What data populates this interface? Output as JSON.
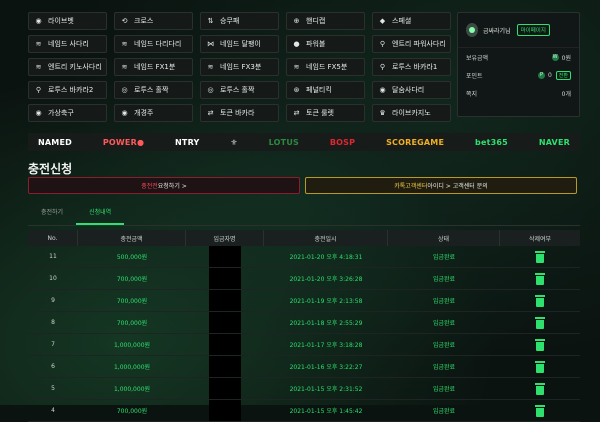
{
  "menu": [
    {
      "icon": "live-icon",
      "glyph": "◉",
      "label": "라이브벳"
    },
    {
      "icon": "cross-icon",
      "glyph": "⟲",
      "label": "크로스"
    },
    {
      "icon": "win-lose-icon",
      "glyph": "⇅",
      "label": "승무패"
    },
    {
      "icon": "handicap-icon",
      "glyph": "⊕",
      "label": "핸디캡"
    },
    {
      "icon": "special-icon",
      "glyph": "◆",
      "label": "스페셜"
    },
    {
      "icon": "ladder-icon",
      "glyph": "≋",
      "label": "네임드 사다리"
    },
    {
      "icon": "ladder-icon",
      "glyph": "≋",
      "label": "네임드 다리다리"
    },
    {
      "icon": "snail-icon",
      "glyph": "⋈",
      "label": "네임드 달팽이"
    },
    {
      "icon": "powerball-icon",
      "glyph": "●",
      "label": "파워볼"
    },
    {
      "icon": "ladder-icon",
      "glyph": "⚲",
      "label": "엔트리 파워사다리"
    },
    {
      "icon": "ladder-icon",
      "glyph": "≋",
      "label": "엔트리 키노사다리"
    },
    {
      "icon": "fx-icon",
      "glyph": "≋",
      "label": "네임드 FX1분"
    },
    {
      "icon": "fx-icon",
      "glyph": "≋",
      "label": "네임드 FX3분"
    },
    {
      "icon": "fx-icon",
      "glyph": "≋",
      "label": "네임드 FX5분"
    },
    {
      "icon": "baccarat-icon",
      "glyph": "⚲",
      "label": "로투스 바카라1"
    },
    {
      "icon": "baccarat-icon",
      "glyph": "⚲",
      "label": "로투스 바카라2"
    },
    {
      "icon": "odd-even-icon",
      "glyph": "◎",
      "label": "로투스 홀짝"
    },
    {
      "icon": "odd-even-icon",
      "glyph": "◎",
      "label": "로투스 홀짝"
    },
    {
      "icon": "penalty-icon",
      "glyph": "⊛",
      "label": "페널티킥"
    },
    {
      "icon": "ladder-icon",
      "glyph": "◉",
      "label": "달숨사다리"
    },
    {
      "icon": "soccer-icon",
      "glyph": "◉",
      "label": "가상축구"
    },
    {
      "icon": "horse-icon",
      "glyph": "◉",
      "label": "개경주"
    },
    {
      "icon": "baccarat-icon",
      "glyph": "⇄",
      "label": "토큰 바카라"
    },
    {
      "icon": "roulette-icon",
      "glyph": "⇄",
      "label": "토큰 룰렛"
    },
    {
      "icon": "crown-icon",
      "glyph": "♛",
      "label": "라이브카지노"
    }
  ],
  "user_panel": {
    "username": "금싸라기님",
    "mypage_label": "마이페이지",
    "balance_label": "보유금액",
    "balance_value": "0원",
    "point_label": "포인트",
    "point_value": "0",
    "convert_label": "전환",
    "message_label": "쪽지",
    "message_value": "0개"
  },
  "logos": [
    {
      "name": "named-logo",
      "text": "NAMED",
      "color": "#ffffff"
    },
    {
      "name": "powerball-logo",
      "text": "POWER●",
      "color": "#ff5a5a"
    },
    {
      "name": "ntry-logo",
      "text": "NTRY",
      "color": "#ffffff"
    },
    {
      "name": "emblem-logo",
      "text": "⚜",
      "color": "#cfd6d2"
    },
    {
      "name": "lotus-logo",
      "text": "LOTUS",
      "color": "#2a8a3e"
    },
    {
      "name": "red-logo",
      "text": "BOSP",
      "color": "#e0262f"
    },
    {
      "name": "scoregame-logo",
      "text": "SCOREGAME",
      "color": "#f0b020"
    },
    {
      "name": "bet365-logo",
      "text": "bet365",
      "color": "#2ee06d"
    },
    {
      "name": "naver-logo",
      "text": "NAVER",
      "color": "#2ee06d"
    }
  ],
  "page_title": "충전신청",
  "notices": {
    "left_highlight": "충전전",
    "left_rest": " 요청하기 >",
    "right_highlight": "카톡고객센터",
    "right_rest": " 아이디 > 고객센터 문의"
  },
  "tabs": [
    "충전하기",
    "신청내역"
  ],
  "table": {
    "headers": [
      "No.",
      "충전금액",
      "입금자명",
      "충전일시",
      "상태",
      "삭제여부"
    ],
    "rows": [
      {
        "no": "11",
        "amount": "500,000원",
        "date": "2021-01-20 오후 4:18:31",
        "status": "입금완료"
      },
      {
        "no": "10",
        "amount": "700,000원",
        "date": "2021-01-20 오후 3:26:28",
        "status": "입금완료"
      },
      {
        "no": "9",
        "amount": "700,000원",
        "date": "2021-01-19 오후 2:13:58",
        "status": "입금완료"
      },
      {
        "no": "8",
        "amount": "700,000원",
        "date": "2021-01-18 오후 2:55:29",
        "status": "입금완료"
      },
      {
        "no": "7",
        "amount": "1,000,000원",
        "date": "2021-01-17 오후 3:18:28",
        "status": "입금완료"
      },
      {
        "no": "6",
        "amount": "1,000,000원",
        "date": "2021-01-16 오후 3:22:27",
        "status": "입금완료"
      },
      {
        "no": "5",
        "amount": "1,000,000원",
        "date": "2021-01-15 오후 2:31:52",
        "status": "입금완료"
      },
      {
        "no": "4",
        "amount": "700,000원",
        "date": "2021-01-15 오후 1:45:42",
        "status": "입금완료"
      }
    ]
  },
  "colors": {
    "accent": "#2ee06d",
    "danger": "#8a1f2b",
    "warning": "#b89a22"
  }
}
